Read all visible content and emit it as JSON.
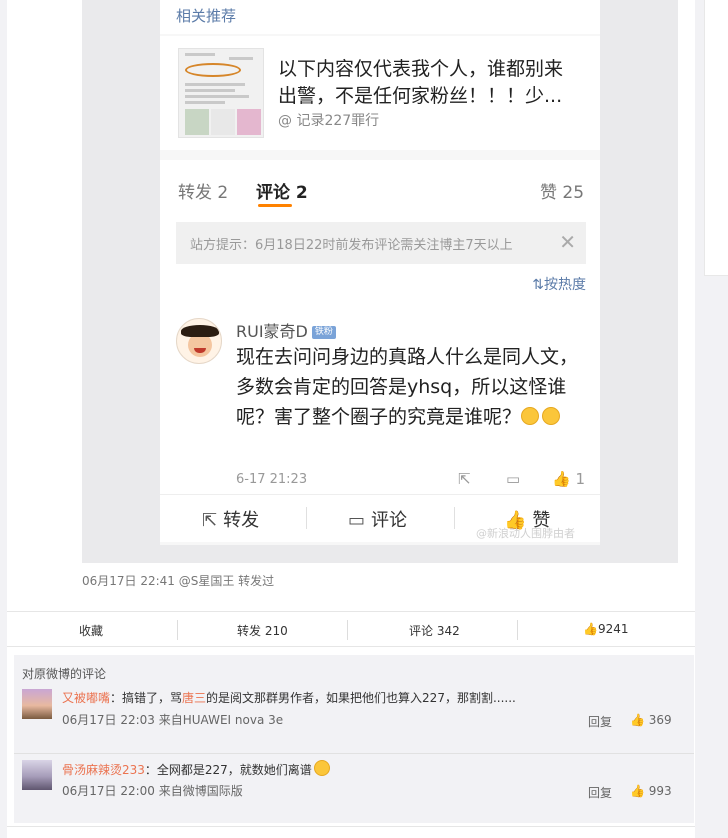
{
  "related": {
    "title": "相关推荐",
    "text": "以下内容仅代表我个人，谁都别来出警，不是任何家粉丝！！！少...",
    "source": "@ 记录227罪行"
  },
  "tabs": {
    "repost": "转发 2",
    "comment": "评论 2",
    "like": "赞 25"
  },
  "notice": {
    "text": "站方提示：6月18日22时前发布评论需关注博主7天以上",
    "close": "✕"
  },
  "sort": "按热度",
  "comment": {
    "name": "RUI蒙奇D",
    "badge": "铁粉",
    "text": "现在去问问身边的真路人什么是同人文，多数会肯定的回答是yhsq，所以这怪谁呢？害了整个圈子的究竟是谁呢？",
    "date": "6-17 21:23",
    "likes": "1"
  },
  "actions": {
    "repost": "转发",
    "comment": "评论",
    "like": "赞"
  },
  "watermark": "@新浪动人围脖由者",
  "repost_info": "06月17日 22:41 @S星国王 转发过",
  "bar": {
    "collect": "收藏",
    "repost": "转发 210",
    "comment": "评论 342",
    "like": "9241"
  },
  "comments": {
    "title": "对原微博的评论",
    "items": [
      {
        "name": "又被嘟嘴",
        "text_before": "：搞错了，骂",
        "highlight": "唐三",
        "text_after": "的是阅文那群男作者，如果把他们也算入227，那割割......",
        "meta": "06月17日 22:03 来自HUAWEI nova 3e",
        "reply": "回复",
        "likes": "369"
      },
      {
        "name": "骨汤麻辣烫233",
        "text": "：全网都是227，就数她们离谱",
        "meta": "06月17日 22:00 来自微博国际版",
        "reply": "回复",
        "likes": "993"
      }
    ]
  },
  "colors": {
    "accent": "#ff8200",
    "link": "#eb7350",
    "blue": "#5b7ba8"
  }
}
